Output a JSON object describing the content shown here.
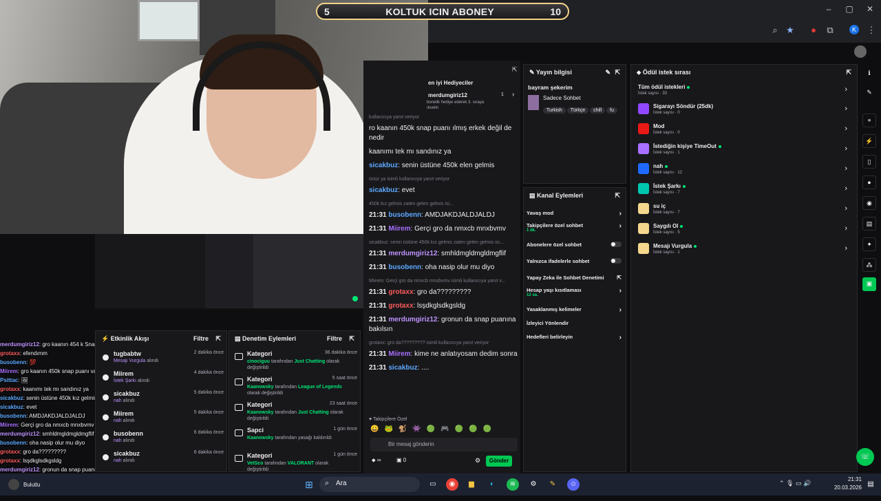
{
  "banner": {
    "left": "5",
    "title": "KOLTUK ICIN ABONEY",
    "right": "10"
  },
  "browser": {
    "profile": "K"
  },
  "overlay_chat": [
    {
      "user": "merdumgiriz12",
      "text": ": gro kaanın 454 k Snap puanı varmışşş @grotaxx",
      "color": "#bf94ff"
    },
    {
      "user": "grotaxx",
      "text": ": efendımm",
      "color": "#ff5c5c"
    },
    {
      "user": "busobenn",
      "text": ": 💯",
      "color": "#5da9ff"
    },
    {
      "user": "Miirem",
      "text": ": gro kaanın 450k snap puanı varmış mı sahipmiş erkek değil de nedir",
      "color": "#a970ff"
    },
    {
      "user": "Psittac",
      "text": ": 🖼",
      "color": "#5da9ff"
    },
    {
      "user": "grotaxx",
      "text": ": kaanımı tek mı sandınız ya",
      "color": "#ff5c5c"
    },
    {
      "user": "sicakbuz",
      "text": ": senin üstüne 450k kız gelmis zaten geleni gelmis",
      "color": "#5da9ff"
    },
    {
      "user": "sicakbuz",
      "text": ": evet",
      "color": "#5da9ff"
    },
    {
      "user": "busobenn",
      "text": ": AMDJAKDJALDJALDJ",
      "color": "#5da9ff"
    },
    {
      "user": "Miirem",
      "text": ": Gerçi gro da nmxcb mnxbvmv",
      "color": "#a970ff"
    },
    {
      "user": "merdumgiriz12",
      "text": ": smhldmgldmgldmgflif",
      "color": "#bf94ff"
    },
    {
      "user": "busobenn",
      "text": ": oha nasip olur mu diyo",
      "color": "#5da9ff"
    },
    {
      "user": "grotaxx",
      "text": ": gro da?????????",
      "color": "#ff5c5c"
    },
    {
      "user": "grotaxx",
      "text": ": lsşdkglsdkgsldg",
      "color": "#ff5c5c"
    },
    {
      "user": "merdumgiriz12",
      "text": ": gronun da snap puanına bakılsın",
      "color": "#bf94ff"
    },
    {
      "user": "Miirem",
      "text": ": kime ne anlatıyosam dedim sonra",
      "color": "#a970ff"
    },
    {
      "user": "sicakbuz",
      "text": ": ....",
      "color": "#5da9ff"
    }
  ],
  "activity": {
    "title": "Etkinlik Akışı",
    "filter": "Filtre",
    "items": [
      {
        "name": "tugbabtw",
        "reward": "Mesajı Vurgula",
        "suffix": "alındı",
        "time": "2 dakika önce"
      },
      {
        "name": "Miirem",
        "reward": "İstek Şarkı",
        "suffix": "alındı",
        "time": "4 dakika önce"
      },
      {
        "name": "sicakbuz",
        "reward": "nah",
        "suffix": "alındı",
        "time": "5 dakika önce"
      },
      {
        "name": "Miirem",
        "reward": "nah",
        "suffix": "alındı",
        "time": "5 dakika önce"
      },
      {
        "name": "busobenn",
        "reward": "nah",
        "suffix": "alındı",
        "time": "6 dakika önce"
      },
      {
        "name": "sicakbuz",
        "reward": "nah",
        "suffix": "alındı",
        "time": "6 dakika önce"
      }
    ]
  },
  "moderation": {
    "title": "Denetim Eylemleri",
    "filter": "Filtre",
    "items": [
      {
        "name": "Kategori",
        "by": "cinociguu",
        "mid": "tarafından",
        "target": "Just Chatting",
        "end": "olarak değiştirildi",
        "time": "36 dakika önce"
      },
      {
        "name": "Kategori",
        "by": "Kaanowsky",
        "mid": "tarafından",
        "target": "League of Legends",
        "end": "olarak değiştirildi",
        "time": "5 saat önce"
      },
      {
        "name": "Kategori",
        "by": "Kaanowsky",
        "mid": "tarafından",
        "target": "Just Chatting",
        "end": "olarak değiştirildi",
        "time": "23 saat önce"
      },
      {
        "name": "Sapci",
        "by": "Kaanowsky",
        "mid": "tarafından yasağı kaldırıldı",
        "target": "",
        "end": "",
        "time": "1 gün önce"
      },
      {
        "name": "Kategori",
        "by": "VetSco",
        "mid": "tarafından",
        "target": "VALORANT",
        "end": "olarak değiştirildi",
        "time": "1 gün önce"
      },
      {
        "name": "Kategori",
        "by": "",
        "mid": "",
        "target": "",
        "end": "",
        "time": ""
      }
    ]
  },
  "hype": {
    "title": "en iyi Hediyeciler",
    "user": "merdumgiriz12",
    "count": "1",
    "line1": "bonelik hediye ederek 3. sıraya",
    "line2": "ıkselin"
  },
  "chat": {
    "messages": [
      {
        "reply": "kullanıcıya yanıt veriyor",
        "time": "",
        "user": "",
        "color": "#bf94ff",
        "text": "ro kaanın 450k snap puanı ılmış erkek değil de nedir"
      },
      {
        "reply": "",
        "time": "",
        "user": "",
        "color": "#efeff1",
        "text": "kaanımı tek mı sandınız ya"
      },
      {
        "reply": "",
        "time": "",
        "user": "sicakbuz",
        "color": "#5da9ff",
        "text": ": senin üstüne 450k elen gelmis"
      },
      {
        "reply": "ünüz ya isimli kullanıcıya yanıt veriyor",
        "time": "",
        "user": "sicakbuz",
        "color": "#5da9ff",
        "text": ": evet"
      },
      {
        "reply": "450k kız gelmis zaten gelen gelmis isi...",
        "time": "21:31",
        "user": "busobenn",
        "color": "#5da9ff",
        "text": ": AMDJAKDJALDJALDJ"
      },
      {
        "reply": "",
        "time": "21:31",
        "user": "Miirem",
        "color": "#a970ff",
        "text": ": Gerçi gro da nmxcb mnxbvmv"
      },
      {
        "reply": "sicakbuz: senin üstüne 450k kız gelmis zaten gelen gelmis isi...",
        "time": "21:31",
        "user": "merdumgiriz12",
        "color": "#bf94ff",
        "text": ": smhldmgldmgldmgflif"
      },
      {
        "reply": "",
        "time": "21:31",
        "user": "busobenn",
        "color": "#5da9ff",
        "text": ": oha nasip olur mu diyo"
      },
      {
        "reply": "Miirem: Gerçi gro da nmxcb mnxbvmv isimli kullanıcıya yanıt v...",
        "time": "21:31",
        "user": "grotaxx",
        "color": "#ff5c5c",
        "text": ": gro da?????????"
      },
      {
        "reply": "",
        "time": "21:31",
        "user": "grotaxx",
        "color": "#ff5c5c",
        "text": ": lsşdkglsdkgsldg"
      },
      {
        "reply": "",
        "time": "21:31",
        "user": "merdumgiriz12",
        "color": "#bf94ff",
        "text": ": gronun da snap puanına bakılsın"
      },
      {
        "reply": "grotaxx: gro da????????? isimli kullanıcıya yanıt veriyor",
        "time": "21:31",
        "user": "Miirem",
        "color": "#a970ff",
        "text": ": kime ne anlatıyosam dedim sonra"
      },
      {
        "reply": "",
        "time": "21:31",
        "user": "sicakbuz",
        "color": "#5da9ff",
        "text": ": ...."
      }
    ],
    "followers_label": "Takipçilere Özel",
    "input_placeholder": "Bir mesaj gönderin",
    "points": "0",
    "send": "Gönder"
  },
  "stream_info": {
    "title": "Yayın bilgisi",
    "stream_title": "bayram şekerim",
    "category": "Sadece Sohbet",
    "tags": [
      "Turkish",
      "Türkçe",
      "chill",
      "fu"
    ]
  },
  "channel_actions": {
    "title": "Kanal Eylemleri",
    "items": [
      {
        "label": "Yavaş mod",
        "sub": "",
        "type": "arrow"
      },
      {
        "label": "Takipçilere özel sohbet",
        "sub": "1 dk.",
        "type": "arrow"
      },
      {
        "label": "Abonelere özel sohbet",
        "sub": "",
        "type": "toggle"
      },
      {
        "label": "Yalnızca ifadelerle sohbet",
        "sub": "",
        "type": "toggle"
      },
      {
        "label": "Yapay Zeka ile Sohbet Denetimi",
        "sub": "",
        "type": "ext"
      },
      {
        "label": "Hesap yaşı kısıtlaması",
        "sub": "12 sa.",
        "type": "arrow"
      },
      {
        "label": "Yasaklanmış kelimeler",
        "sub": "",
        "type": "arrow"
      },
      {
        "label": "İzleyici Yönlendir",
        "sub": "",
        "type": "none"
      },
      {
        "label": "Hedefleri belirleyin",
        "sub": "",
        "type": "arrow"
      }
    ]
  },
  "rewards": {
    "title": "Ödül istek sırası",
    "all_label": "Tüm ödül istekleri",
    "all_count": "İstek sayısı · 33",
    "items": [
      {
        "name": "Sigarayı Söndür (25dk)",
        "count": "İstek sayısı · 0",
        "color": "#9147ff",
        "active": false
      },
      {
        "name": "Mod",
        "count": "İstek sayısı · 0",
        "color": "#e91916",
        "active": false
      },
      {
        "name": "İstediğin kişiye TimeOut",
        "count": "İstek sayısı · 1",
        "color": "#a970ff",
        "active": true
      },
      {
        "name": "nah",
        "count": "İstek sayısı · 12",
        "color": "#1f69ff",
        "active": true
      },
      {
        "name": "İstek Şarkı",
        "count": "İstek sayısı · 7",
        "color": "#00c8af",
        "active": true
      },
      {
        "name": "su iç",
        "count": "İstek sayısı · 7",
        "color": "#f5d78e",
        "active": false
      },
      {
        "name": "Saygılı Ol",
        "count": "İstek sayısı · 5",
        "color": "#f5d78e",
        "active": true
      },
      {
        "name": "Mesajı Vurgula",
        "count": "İstek sayısı · 1",
        "color": "#f5d78e",
        "active": true
      }
    ]
  },
  "taskbar": {
    "search": "Ara",
    "time": "21:31",
    "date": "20.03.2026",
    "weather": "Bulutlu"
  }
}
